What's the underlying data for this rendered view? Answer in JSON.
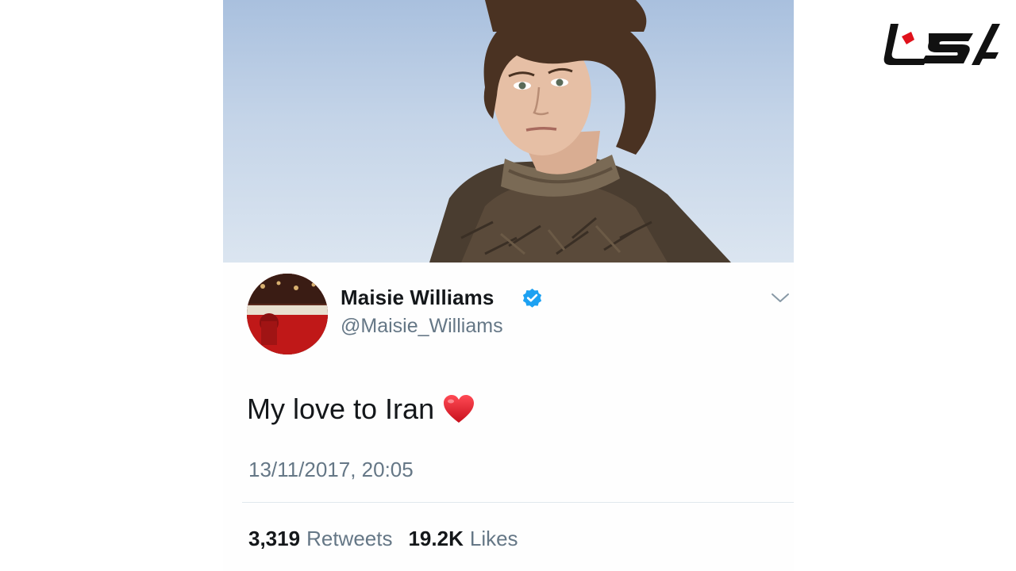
{
  "logo": {
    "icon": "site-logo-icon",
    "color": "#111111",
    "accent": "#e0111b"
  },
  "tweet": {
    "display_name": "Maisie Williams",
    "handle": "@Maisie_Williams",
    "verified": true,
    "text": "My love to Iran",
    "emoji": "heart-emoji",
    "timestamp": "13/11/2017, 20:05",
    "retweets_count": "3,319",
    "retweets_label": "Retweets",
    "likes_count": "19.2K",
    "likes_label": "Likes"
  },
  "colors": {
    "verified_blue": "#1da1f2",
    "text_primary": "#14171a",
    "text_secondary": "#657786",
    "heart_red": "#e0202e"
  }
}
